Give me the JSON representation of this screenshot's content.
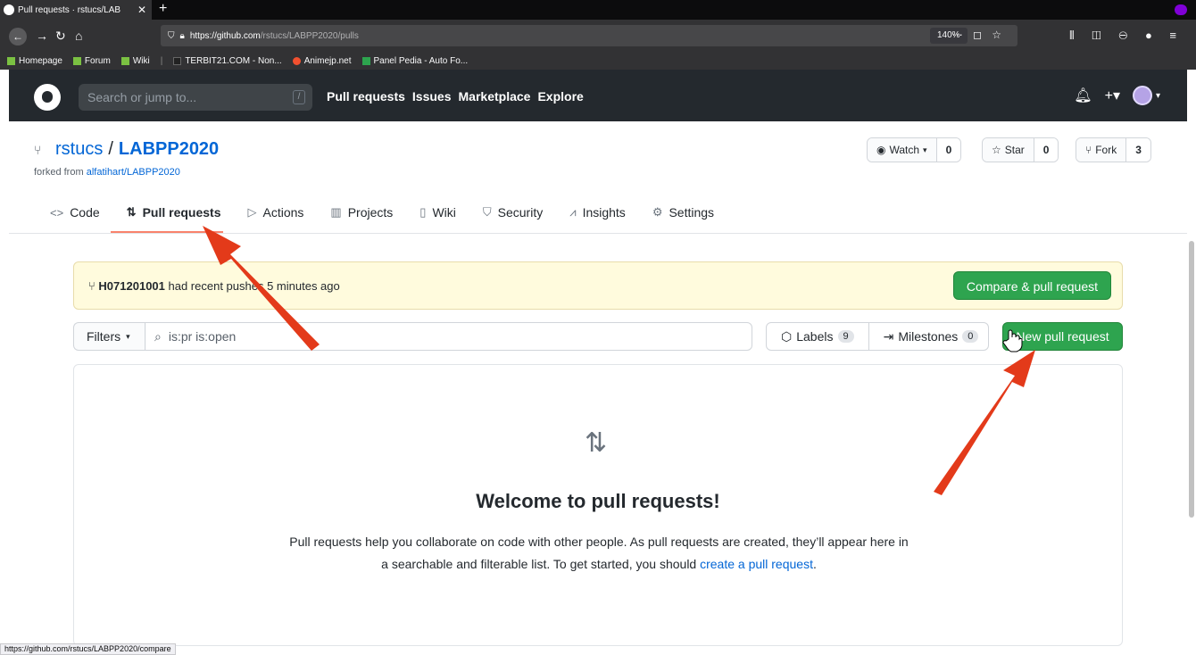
{
  "browser": {
    "tab_title": "Pull requests · rstucs/LAB",
    "tab_close": "✕",
    "new_tab": "+",
    "url_host": "https://github.com",
    "url_path": "/rstucs/LABPP2020/pulls",
    "zoom": "140%",
    "page_actions": "⋯ ◻ ☆",
    "toolbar_icons": "⫴ ◫ ⊖ ●  ≡",
    "status_url": "https://github.com/rstucs/LABPP2020/compare",
    "bookmarks": [
      {
        "label": "Homepage"
      },
      {
        "label": "Forum"
      },
      {
        "label": "Wiki"
      },
      {
        "label": "TERBIT21.COM - Non..."
      },
      {
        "label": "Animejp.net"
      },
      {
        "label": "Panel Pedia - Auto Fo..."
      }
    ]
  },
  "github": {
    "search_placeholder": "Search or jump to...",
    "search_shortcut": "/",
    "nav": [
      "Pull requests",
      "Issues",
      "Marketplace",
      "Explore"
    ]
  },
  "repo": {
    "owner": "rstucs",
    "separator": "/",
    "name": "LABPP2020",
    "forked_prefix": "forked from",
    "forked_from": "alfatihart/LABPP2020",
    "watch": {
      "label": "Watch",
      "count": "0"
    },
    "star": {
      "label": "Star",
      "count": "0"
    },
    "fork": {
      "label": "Fork",
      "count": "3"
    },
    "tabs": [
      {
        "icon": "<>",
        "label": "Code"
      },
      {
        "icon": "⇅",
        "label": "Pull requests"
      },
      {
        "icon": "▷",
        "label": "Actions"
      },
      {
        "icon": "▥",
        "label": "Projects"
      },
      {
        "icon": "▯",
        "label": "Wiki"
      },
      {
        "icon": "⛉",
        "label": "Security"
      },
      {
        "icon": "⩘",
        "label": "Insights"
      },
      {
        "icon": "⚙",
        "label": "Settings"
      }
    ]
  },
  "banner": {
    "branch": "H071201001",
    "text": " had recent pushes 5 minutes ago",
    "button": "Compare & pull request"
  },
  "filters": {
    "label": "Filters",
    "query": "is:pr is:open",
    "labels": {
      "label": "Labels",
      "count": "9"
    },
    "milestones": {
      "label": "Milestones",
      "count": "0"
    },
    "new_button": "New pull request"
  },
  "blankslate": {
    "title": "Welcome to pull requests!",
    "desc_1": "Pull requests help you collaborate on code with other people. As pull requests are created, they’ll appear here in a searchable and filterable list. To get started, you should ",
    "link": "create a pull request",
    "desc_2": "."
  },
  "colors": {
    "green": "#2ea44f",
    "link": "#0366d6",
    "header_bg": "#24292e",
    "banner_bg": "#fffbdd",
    "arrow": "#e33a1a"
  }
}
